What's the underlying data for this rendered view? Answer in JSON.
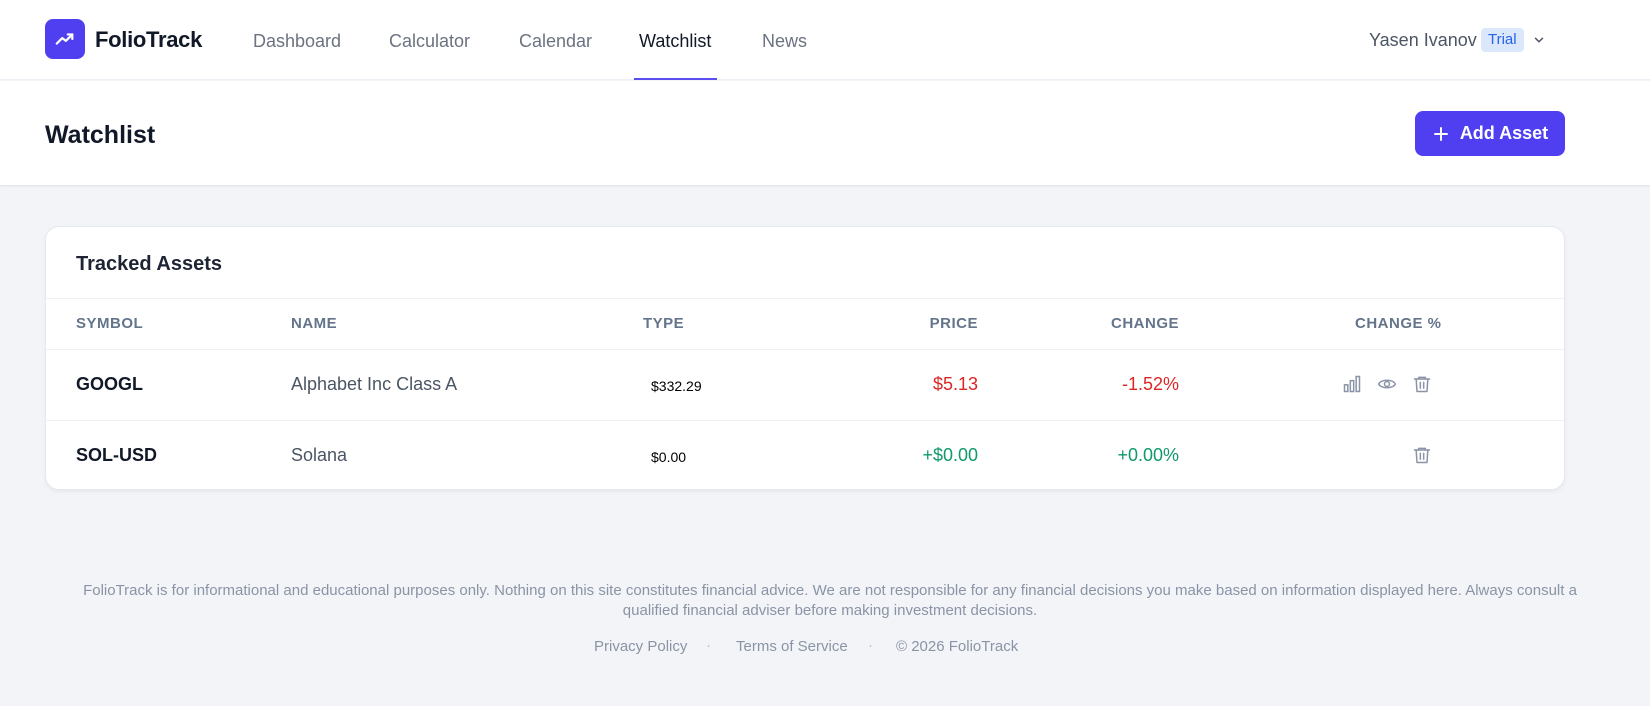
{
  "brand": {
    "name": "FolioTrack",
    "icon": "trend-up-icon",
    "color": "#4f3ff0"
  },
  "nav": {
    "items": [
      {
        "label": "Dashboard"
      },
      {
        "label": "Calculator"
      },
      {
        "label": "Calendar"
      },
      {
        "label": "Watchlist",
        "active": true
      },
      {
        "label": "News"
      }
    ]
  },
  "user": {
    "name": "Yasen Ivanov",
    "badge": "Trial",
    "menu_icon": "chevron-down-icon"
  },
  "page": {
    "title": "Watchlist"
  },
  "actions": {
    "add_asset": "Add Asset",
    "add_icon": "plus-icon"
  },
  "table": {
    "title": "Tracked Assets",
    "columns": [
      "SYMBOL",
      "NAME",
      "TYPE",
      "PRICE",
      "CHANGE",
      "CHANGE %"
    ],
    "rows": [
      {
        "symbol": "GOOGL",
        "name": "Alphabet Inc Class A",
        "type": "$332.29",
        "price": "$5.13",
        "change": "-1.52%",
        "direction": "negative",
        "actions": [
          "chart-icon",
          "eye-icon",
          "trash-icon"
        ]
      },
      {
        "symbol": "SOL-USD",
        "name": "Solana",
        "type": "$0.00",
        "price": "+$0.00",
        "change": "+0.00%",
        "direction": "positive",
        "actions": [
          "trash-icon"
        ]
      }
    ]
  },
  "colors": {
    "accent": "#4f3ff0",
    "positive": "#0f9a6a",
    "negative": "#dc2626"
  },
  "footer": {
    "disclaimer_line1": "FolioTrack is for informational and educational purposes only. Nothing on this site constitutes financial advice. We are not responsible for any financial decisions you make based on information displayed here. Always consult a",
    "disclaimer_line2": "qualified financial adviser before making investment decisions.",
    "links": [
      "Privacy Policy",
      "Terms of Service"
    ],
    "separator": "·",
    "copyright": "© 2026 FolioTrack"
  }
}
